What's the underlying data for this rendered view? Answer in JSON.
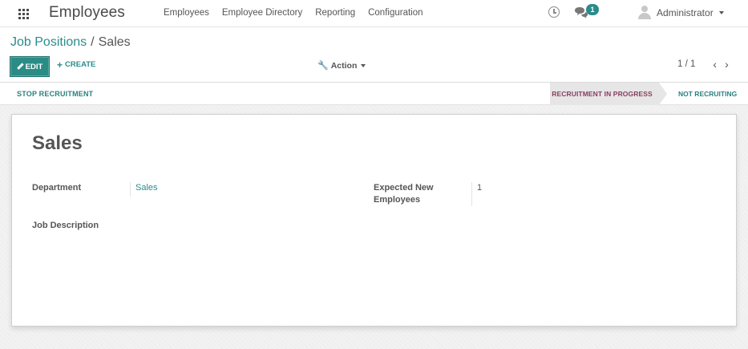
{
  "navbar": {
    "app_title": "Employees",
    "menu": [
      {
        "label": "Employees"
      },
      {
        "label": "Employee Directory"
      },
      {
        "label": "Reporting"
      },
      {
        "label": "Configuration"
      }
    ],
    "chat_badge_count": "1",
    "user_name": "Administrator",
    "icons": {
      "apps": "grid-icon",
      "activity": "clock-icon",
      "messages": "chat-icon",
      "user": "avatar-icon"
    }
  },
  "control_panel": {
    "breadcrumb": {
      "parent": "Job Positions",
      "separator": "/",
      "current": "Sales"
    },
    "edit_label": "EDIT",
    "create_label": "CREATE",
    "action_label": "Action",
    "pager": {
      "value": "1 / 1",
      "prev": "‹",
      "next": "›"
    }
  },
  "statusbar": {
    "stop_label": "STOP RECRUITMENT",
    "stages": [
      {
        "label": "RECRUITMENT IN PROGRESS",
        "active": true
      },
      {
        "label": "NOT RECRUITING",
        "active": false
      }
    ]
  },
  "form": {
    "title": "Sales",
    "department_label": "Department",
    "department_value": "Sales",
    "expected_label": "Expected New Employees",
    "expected_value": "1",
    "job_description_label": "Job Description"
  },
  "colors": {
    "brand": "#2b8c86",
    "link": "#2a8c8c",
    "active_stage_text": "#8a3d5f"
  }
}
